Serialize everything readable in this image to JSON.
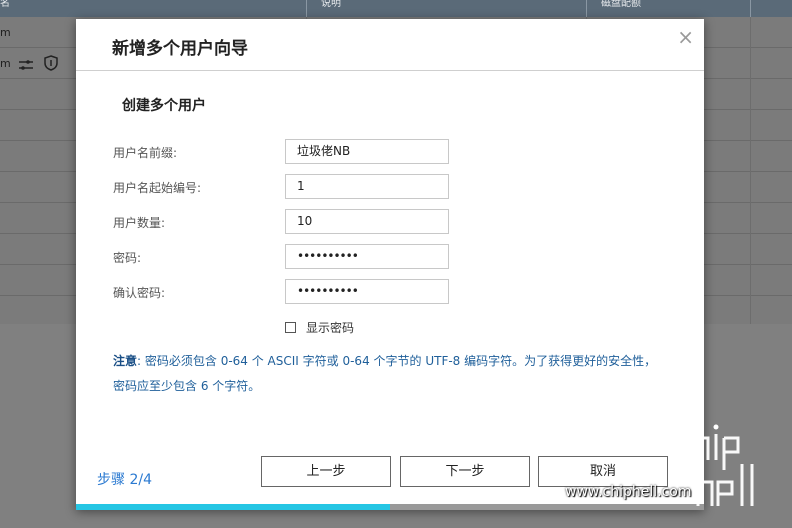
{
  "background": {
    "header_cols": [
      "名",
      "说明",
      "磁盘配额"
    ],
    "row_text": "m",
    "icons": [
      "sliders-icon",
      "shield-icon"
    ]
  },
  "dialog": {
    "title": "新增多个用户向导",
    "close": "×",
    "section_title": "创建多个用户",
    "fields": [
      {
        "label": "用户名前缀:",
        "value": "垃圾佬NB"
      },
      {
        "label": "用户名起始编号:",
        "value": "1"
      },
      {
        "label": "用户数量:",
        "value": "10"
      },
      {
        "label": "密码:",
        "value": "••••••••••"
      },
      {
        "label": "确认密码:",
        "value": "••••••••••"
      }
    ],
    "show_password": "显示密码",
    "note_prefix": "注意",
    "note_line1": ": 密码必须包含 0-64 个 ASCII 字符或 0-64 个字节的 UTF-8 编码字符。为了获得更好的安全性，",
    "note_line2": "密码应至少包含 6 个字符。",
    "step": "步骤 2/4",
    "buttons": {
      "prev": "上一步",
      "next": "下一步",
      "cancel": "取消"
    },
    "progress": 0.5
  },
  "watermark": {
    "logo": "chip hell",
    "url": "www.chiphell.com"
  },
  "colors": {
    "accent": "#2b7ad1",
    "progress": "#26c6e4",
    "note": "#1f5f9a"
  }
}
